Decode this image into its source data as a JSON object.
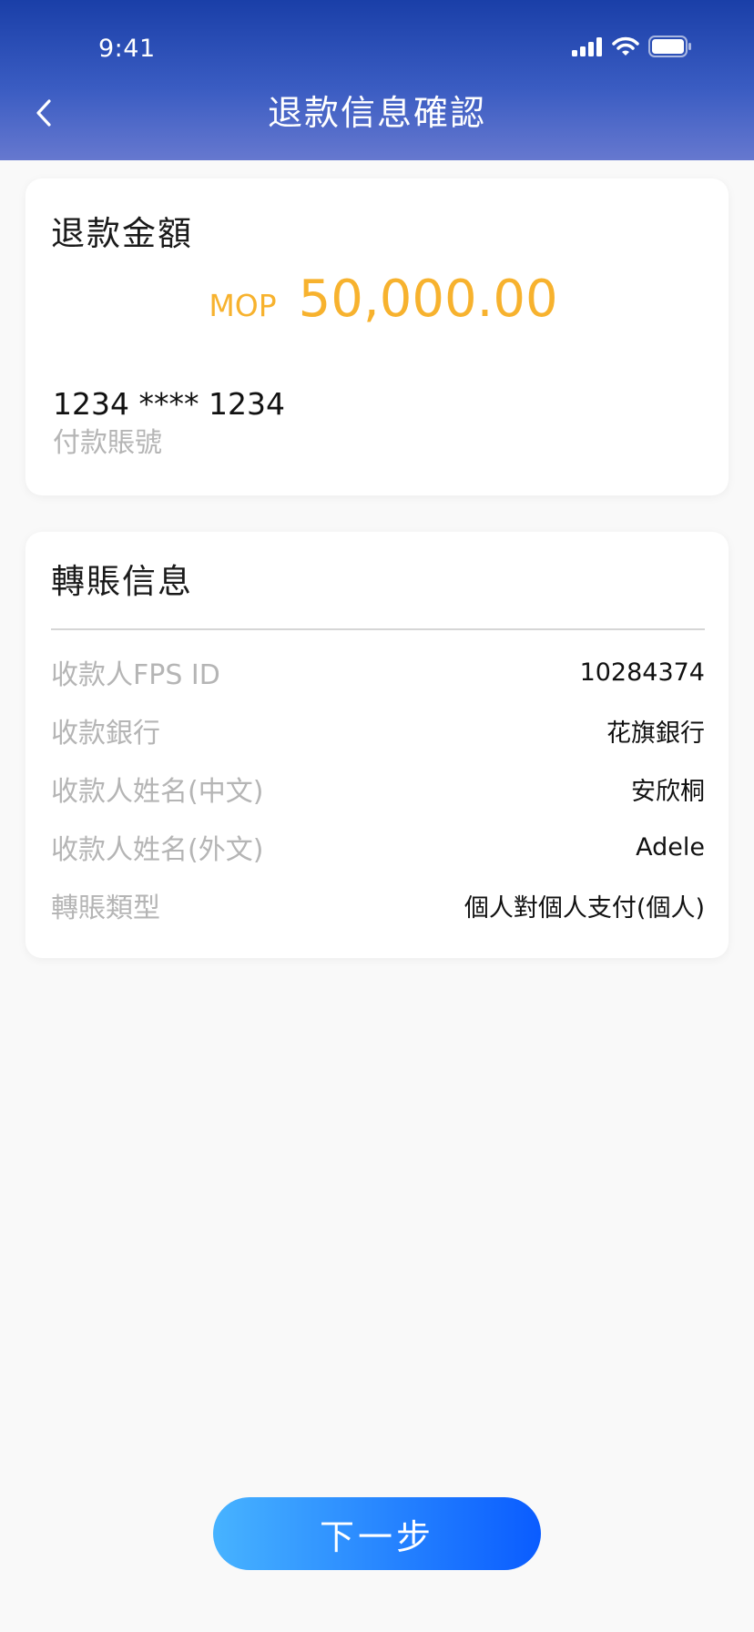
{
  "status_bar": {
    "time": "9:41",
    "icons": [
      "signal-icon",
      "wifi-icon",
      "battery-icon"
    ]
  },
  "header": {
    "title": "退款信息確認",
    "back_icon": "chevron-left-icon"
  },
  "refund_card": {
    "title": "退款金額",
    "currency": "MOP",
    "amount": "50,000.00",
    "account_number": "1234 **** 1234",
    "account_label": "付款賬號"
  },
  "transfer_card": {
    "title": "轉賬信息",
    "rows": [
      {
        "label": "收款人FPS ID",
        "value": "10284374"
      },
      {
        "label": "收款銀行",
        "value": "花旗銀行"
      },
      {
        "label": "收款人姓名(中文)",
        "value": "安欣桐"
      },
      {
        "label": "收款人姓名(外文)",
        "value": "Adele"
      },
      {
        "label": "轉賬類型",
        "value": "個人對個人支付(個人)"
      }
    ]
  },
  "actions": {
    "next_label": "下一步"
  },
  "colors": {
    "header_gradient_top": "#1a3fa8",
    "header_gradient_bottom": "#6678cf",
    "amount": "#f7b22e",
    "label_gray": "#b5b5b5",
    "button_gradient_start": "#47b3ff",
    "button_gradient_end": "#0a5cff"
  }
}
